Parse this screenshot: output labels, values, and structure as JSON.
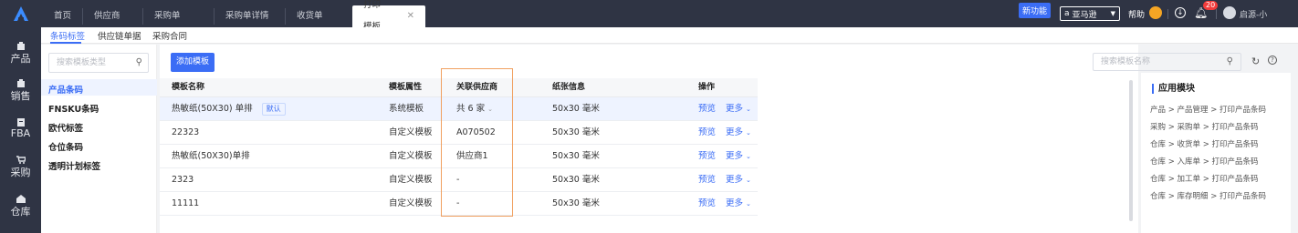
{
  "top_tabs": [
    {
      "label": "首页"
    },
    {
      "label": "供应商"
    },
    {
      "label": "采购单"
    },
    {
      "label": "采购单详情"
    },
    {
      "label": "收货单"
    },
    {
      "label": "打印模板",
      "active": true
    }
  ],
  "topbar": {
    "new_feature": "新功能",
    "account": "亚马逊",
    "help": "帮助",
    "notif_count": "20",
    "user": "启源-小"
  },
  "leftnav": [
    {
      "label": "产品",
      "icon": "box-icon"
    },
    {
      "label": "销售",
      "icon": "sales-icon"
    },
    {
      "label": "FBA",
      "icon": "fba-icon"
    },
    {
      "label": "采购",
      "icon": "cart-icon"
    },
    {
      "label": "仓库",
      "icon": "warehouse-icon"
    }
  ],
  "subtabs": [
    "条码标签",
    "供应链单据",
    "采购合同"
  ],
  "left": {
    "search_placeholder": "搜索模板类型",
    "categories": [
      "产品条码",
      "FNSKU条码",
      "欧代标签",
      "仓位条码",
      "透明计划标签"
    ]
  },
  "main": {
    "add_button": "添加模板",
    "search_placeholder": "搜索模板名称",
    "columns": [
      "模板名称",
      "模板属性",
      "关联供应商",
      "纸张信息",
      "操作"
    ],
    "rows": [
      {
        "name": "热敏纸(50X30) 单排",
        "default_tag": "默认",
        "attr": "系统模板",
        "supplier": "共 6 家",
        "paper": "50x30 毫米",
        "preview": "预览",
        "more": "更多"
      },
      {
        "name": "22323",
        "default_tag": "",
        "attr": "自定义模板",
        "supplier": "A070502",
        "paper": "50x30 毫米",
        "preview": "预览",
        "more": "更多"
      },
      {
        "name": "热敏纸(50X30)单排",
        "default_tag": "",
        "attr": "自定义模板",
        "supplier": "供应商1",
        "paper": "50x30 毫米",
        "preview": "预览",
        "more": "更多"
      },
      {
        "name": "2323",
        "default_tag": "",
        "attr": "自定义模板",
        "supplier": "-",
        "paper": "50x30 毫米",
        "preview": "预览",
        "more": "更多"
      },
      {
        "name": "11111",
        "default_tag": "",
        "attr": "自定义模板",
        "supplier": "-",
        "paper": "50x30 毫米",
        "preview": "预览",
        "more": "更多"
      }
    ]
  },
  "right": {
    "title": "应用模块",
    "items": [
      "产品 > 产品管理 > 打印产品条码",
      "采购 > 采购单 > 打印产品条码",
      "仓库 > 收货单 > 打印产品条码",
      "仓库 > 入库单 > 打印产品条码",
      "仓库 > 加工单 > 打印产品条码",
      "仓库 > 库存明细 > 打印产品条码"
    ]
  },
  "colors": {
    "accent": "#3b6df5",
    "topbar": "#2f3444",
    "highlight_box": "#f0a060"
  }
}
